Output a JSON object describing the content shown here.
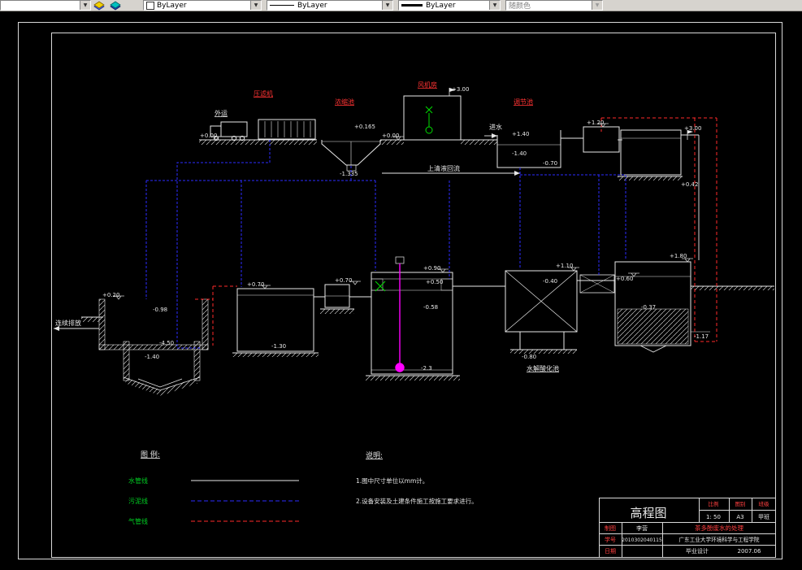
{
  "toolbar": {
    "layer_value": "",
    "color_value": "ByLayer",
    "linetype_value": "ByLayer",
    "lineweight_value": "ByLayer",
    "plotstyle_value": "随颜色"
  },
  "drawing": {
    "equipment": {
      "filter_press": "压滤机",
      "haul_away": "外运",
      "thickener": "浓缩池",
      "blower_room": "风机房",
      "regulating_tank": "调节池",
      "influent": "进水",
      "supernatant_return": "上清液回流",
      "hydrolysis_tank": "水解酸化池",
      "continuous_discharge": "连续排放"
    },
    "elevations": {
      "blower_roof": "+3.00",
      "ground_left": "+0.00",
      "ground_mid": "+0.00",
      "thickener_top": "+0.165",
      "thickener_bottom": "-1.335",
      "reg_in": "+1.40",
      "reg_bottom": "-1.40",
      "reg_out": "-0.70",
      "lift_tank_top": "+1.20",
      "right_pipe_top": "+3.00",
      "right_pipe_mid": "+0.42",
      "anaer_top": "+0.20",
      "anaer_level": "-0.98",
      "anaer_bottom": "-1.40",
      "anaer_pit": "-4.50",
      "aer_top": "+0.70",
      "aer_bottom": "-1.30",
      "pump_top": "+0.70",
      "reactor_top": "+0.90",
      "reactor_level": "+0.50",
      "reactor_mid": "-0.58",
      "reactor_bottom": "-2.3",
      "hyd_top": "+1.10",
      "hyd_level": "-0.40",
      "hyd_base": "-0.80",
      "sed_top": "+1.80",
      "sed_level": "+0.60",
      "sed_mid": "-0.37",
      "sed_out": "-1.17"
    }
  },
  "legend": {
    "title": "图 例:",
    "items": [
      {
        "label": "水管线",
        "color": "#e8e8e8",
        "style": "solid"
      },
      {
        "label": "污泥线",
        "color": "#2b2bff",
        "style": "dashed"
      },
      {
        "label": "气管线",
        "color": "#ff2a2a",
        "style": "dashed"
      }
    ]
  },
  "notes": {
    "title": "说明:",
    "item1": "1.图中尺寸单位以mm计。",
    "item2": "2.设备安装及土建条件施工按施工要求进行。"
  },
  "titleblock": {
    "drawing_name": "高程图",
    "scale_label": "比例",
    "scale_value": "1: 50",
    "sheet_label": "图别",
    "sheet_value": "A3",
    "class_label": "班级",
    "class_value": "甲班",
    "drafter_label": "制图",
    "drafter_value": "李营",
    "student_id_label": "学号",
    "student_id_value": "2010302040115",
    "date_label": "日期",
    "date_value": "",
    "project_title": "茶多酚废水的处理",
    "school": "广东工业大学环境科学与工程学院",
    "design_type": "毕业设计",
    "date": "2007.06"
  }
}
